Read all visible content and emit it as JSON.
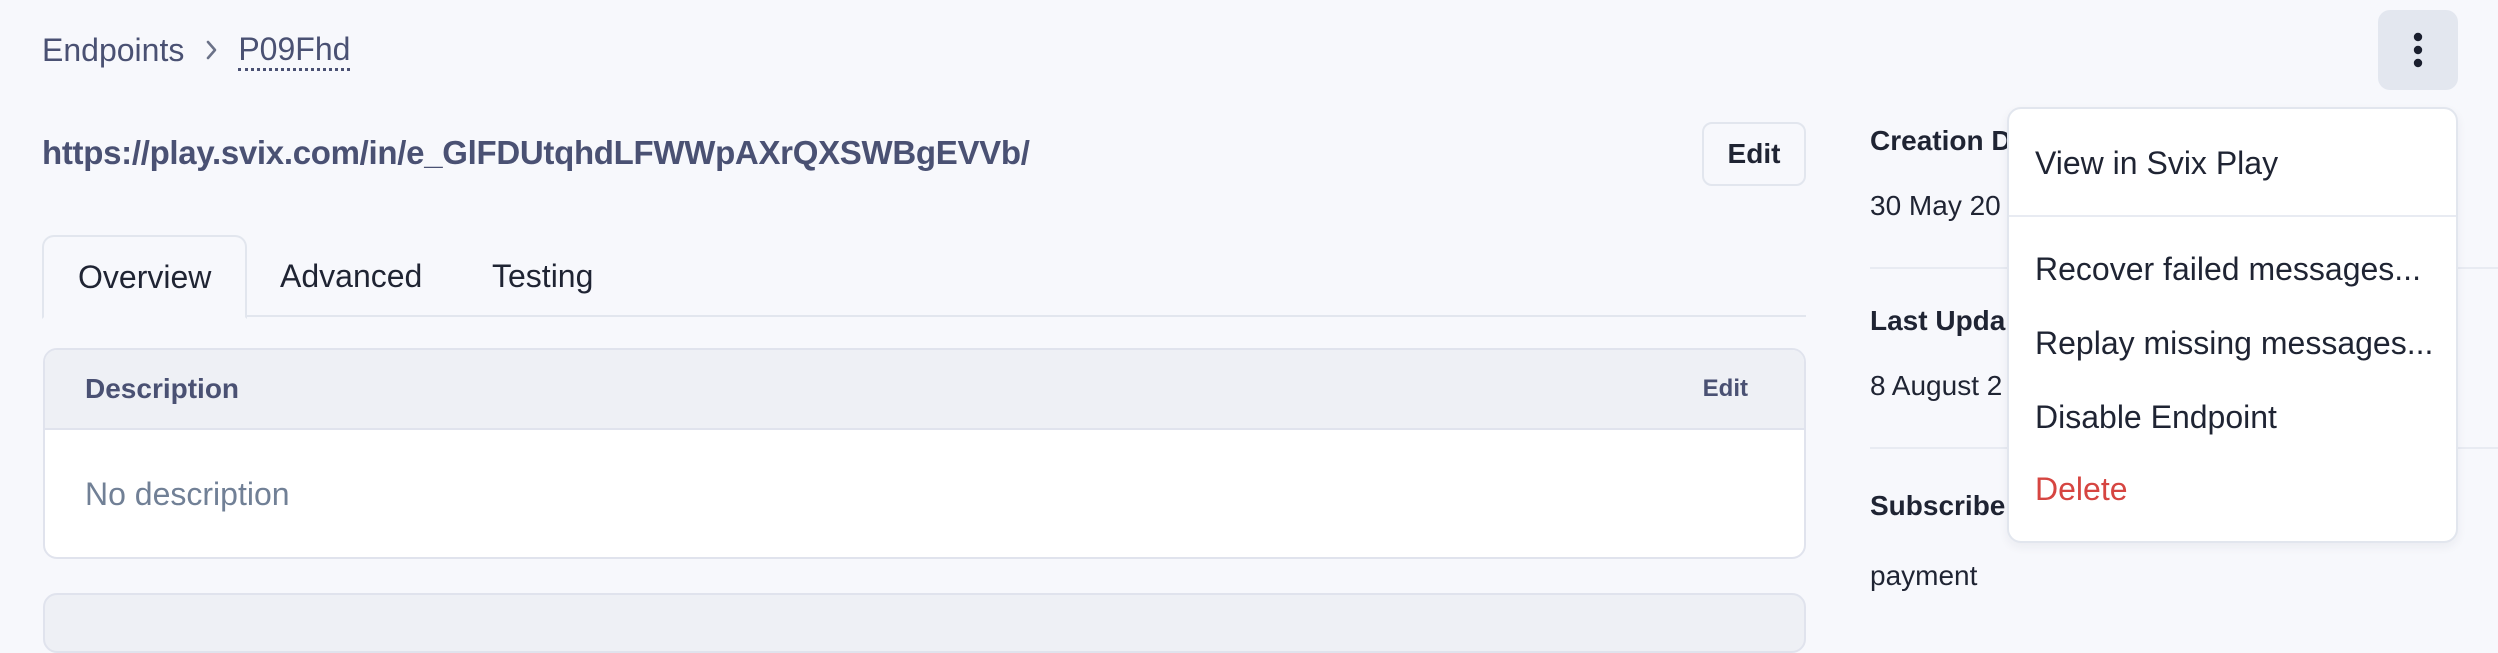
{
  "breadcrumb": {
    "parent": "Endpoints",
    "separator_icon": "chevron-right-icon",
    "current": "P09Fhd"
  },
  "header": {
    "url": "https://play.svix.com/in/e_GlFDUtqhdLFWWpAXrQXSWBgEVVb/",
    "edit_label": "Edit",
    "more_icon": "more-vertical-icon"
  },
  "tabs": [
    {
      "label": "Overview",
      "active": true
    },
    {
      "label": "Advanced",
      "active": false
    },
    {
      "label": "Testing",
      "active": false
    }
  ],
  "description_card": {
    "title": "Description",
    "edit_label": "Edit",
    "body": "No description"
  },
  "sidebar": {
    "creation_label": "Creation D",
    "creation_value": "30 May 20",
    "updated_label": "Last Upda",
    "updated_value": "8 August 2",
    "subscribed_label": "Subscribe",
    "subscribed_value": "payment"
  },
  "menu": {
    "items": [
      {
        "label": "View in Svix Play"
      },
      {
        "label": "Recover failed messages..."
      },
      {
        "label": "Replay missing messages..."
      },
      {
        "label": "Disable Endpoint"
      },
      {
        "label": "Delete",
        "danger": true
      }
    ],
    "danger_color": "#d64541"
  }
}
